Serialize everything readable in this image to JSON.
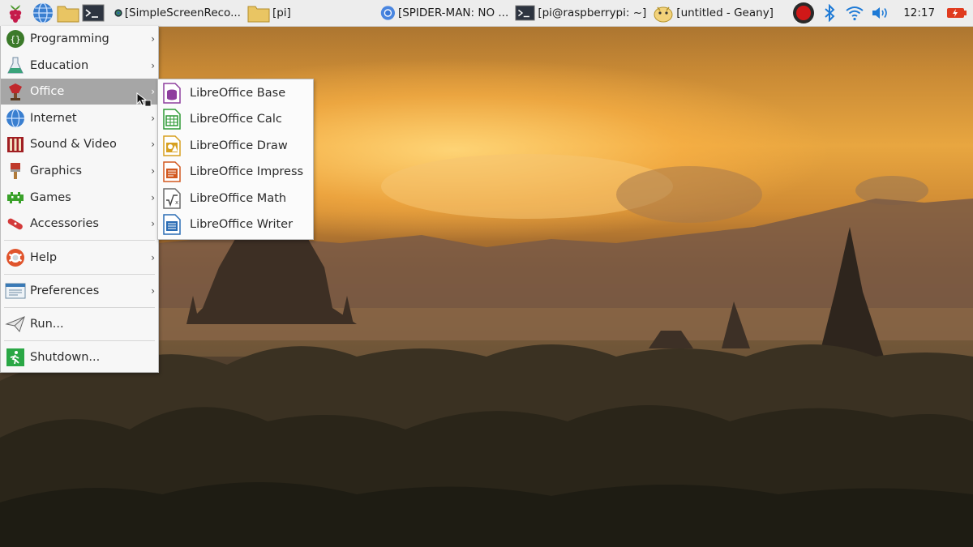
{
  "panel": {
    "tasks": [
      {
        "label": "[SimpleScreenReco...",
        "icon": "screen-recorder-icon"
      },
      {
        "label": "[pi]",
        "icon": "folder-icon"
      },
      {
        "label": "[SPIDER-MAN: NO ...",
        "icon": "chromium-icon"
      },
      {
        "label": "[pi@raspberrypi: ~]",
        "icon": "terminal-icon"
      },
      {
        "label": "[untitled - Geany]",
        "icon": "geany-icon"
      }
    ],
    "clock": "12:17"
  },
  "main_menu": {
    "items": [
      {
        "label": "Programming",
        "icon": "programming-icon"
      },
      {
        "label": "Education",
        "icon": "education-icon"
      },
      {
        "label": "Office",
        "icon": "office-icon"
      },
      {
        "label": "Internet",
        "icon": "internet-icon"
      },
      {
        "label": "Sound & Video",
        "icon": "sound-video-icon"
      },
      {
        "label": "Graphics",
        "icon": "graphics-icon"
      },
      {
        "label": "Games",
        "icon": "games-icon"
      },
      {
        "label": "Accessories",
        "icon": "accessories-icon"
      },
      {
        "label": "Help",
        "icon": "help-icon"
      },
      {
        "label": "Preferences",
        "icon": "preferences-icon"
      },
      {
        "label": "Run...",
        "icon": "run-icon"
      },
      {
        "label": "Shutdown...",
        "icon": "shutdown-icon"
      }
    ],
    "active": "Office"
  },
  "office_submenu": {
    "items": [
      {
        "label": "LibreOffice Base",
        "color": "#8e3e9e"
      },
      {
        "label": "LibreOffice Calc",
        "color": "#2f9a36"
      },
      {
        "label": "LibreOffice Draw",
        "color": "#d7a020"
      },
      {
        "label": "LibreOffice Impress",
        "color": "#d2581f"
      },
      {
        "label": "LibreOffice Math",
        "color": "#6b6b6b"
      },
      {
        "label": "LibreOffice Writer",
        "color": "#2a6cb4"
      }
    ]
  }
}
